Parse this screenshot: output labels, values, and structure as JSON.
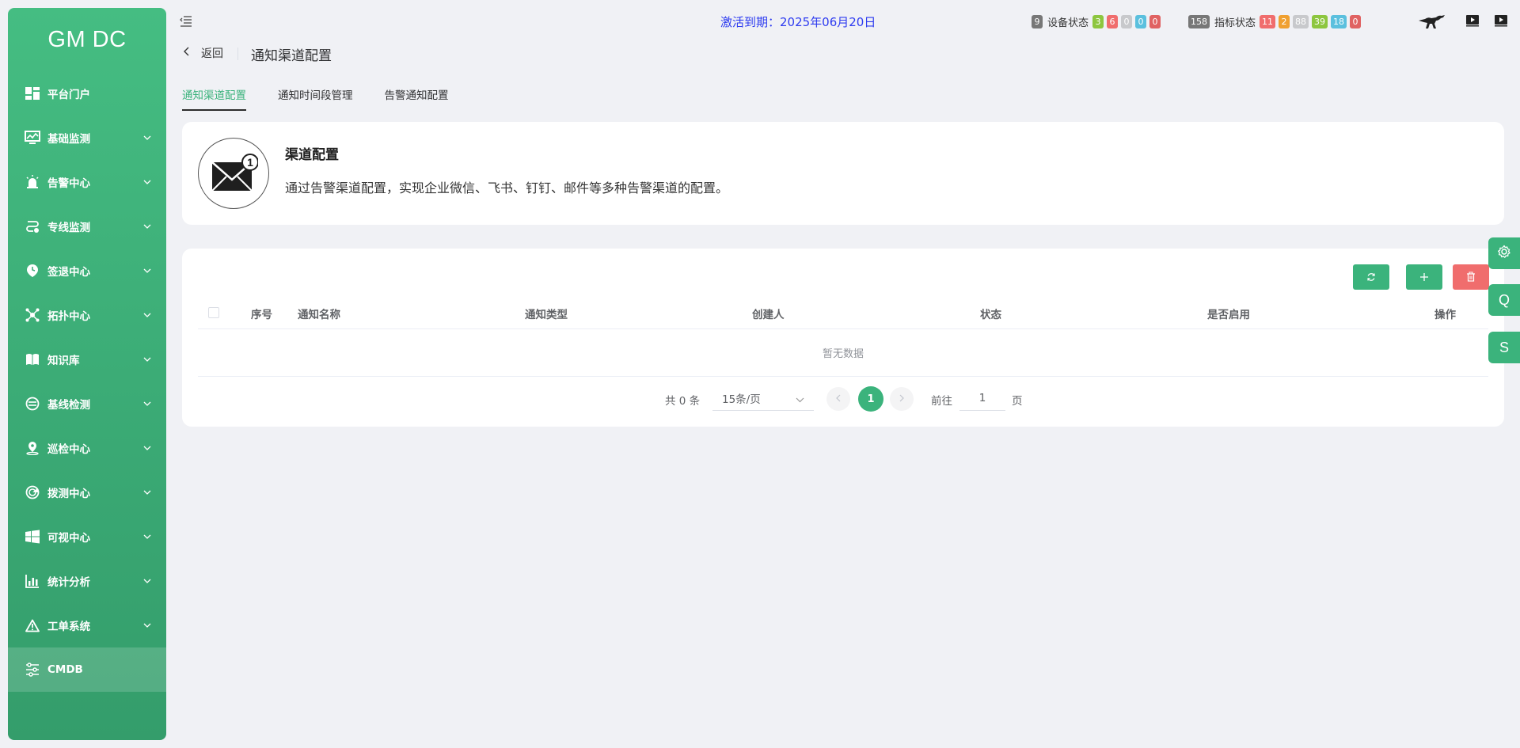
{
  "app": {
    "logo": "GM DC"
  },
  "sidebar": {
    "items": [
      {
        "label": "平台门户",
        "icon": "dashboard-icon",
        "has_children": false
      },
      {
        "label": "基础监测",
        "icon": "monitor-chart-icon",
        "has_children": true
      },
      {
        "label": "告警中心",
        "icon": "alarm-light-icon",
        "has_children": true
      },
      {
        "label": "专线监测",
        "icon": "route-icon",
        "has_children": true
      },
      {
        "label": "签退中心",
        "icon": "clock-pin-icon",
        "has_children": true
      },
      {
        "label": "拓扑中心",
        "icon": "topology-icon",
        "has_children": true
      },
      {
        "label": "知识库",
        "icon": "book-icon",
        "has_children": true
      },
      {
        "label": "基线检测",
        "icon": "baseline-icon",
        "has_children": true
      },
      {
        "label": "巡检中心",
        "icon": "location-pin-icon",
        "has_children": true
      },
      {
        "label": "拨测中心",
        "icon": "radar-icon",
        "has_children": true
      },
      {
        "label": "可视中心",
        "icon": "windows-icon",
        "has_children": true
      },
      {
        "label": "统计分析",
        "icon": "bar-chart-icon",
        "has_children": true
      },
      {
        "label": "工单系统",
        "icon": "warning-triangle-icon",
        "has_children": true
      },
      {
        "label": "CMDB",
        "icon": "sliders-icon",
        "has_children": false,
        "active": true
      }
    ]
  },
  "topbar": {
    "activation_text": "激活到期：2025年06月20日",
    "device_status": {
      "total": "9",
      "label": "设备状态",
      "badges": [
        {
          "value": "3",
          "color": "#8dc63f"
        },
        {
          "value": "6",
          "color": "#f06d6d"
        },
        {
          "value": "0",
          "color": "#c8c9cc"
        },
        {
          "value": "0",
          "color": "#5bc0de"
        },
        {
          "value": "0",
          "color": "#e06262"
        }
      ]
    },
    "metric_status": {
      "total": "158",
      "label": "指标状态",
      "badges": [
        {
          "value": "11",
          "color": "#f06d6d"
        },
        {
          "value": "2",
          "color": "#f0a030"
        },
        {
          "value": "88",
          "color": "#c8c9cc"
        },
        {
          "value": "39",
          "color": "#8dc63f"
        },
        {
          "value": "18",
          "color": "#5bc0de"
        },
        {
          "value": "0",
          "color": "#e06262"
        }
      ]
    }
  },
  "page": {
    "back_label": "返回",
    "title": "通知渠道配置",
    "tabs": [
      {
        "label": "通知渠道配置",
        "active": true
      },
      {
        "label": "通知时间段管理",
        "active": false
      },
      {
        "label": "告警通知配置",
        "active": false
      }
    ]
  },
  "info_card": {
    "title": "渠道配置",
    "description": "通过告警渠道配置，实现企业微信、飞书、钉钉、邮件等多种告警渠道的配置。"
  },
  "table": {
    "columns": [
      "序号",
      "通知名称",
      "通知类型",
      "创建人",
      "状态",
      "是否启用",
      "操作"
    ],
    "rows": [],
    "empty_text": "暂无数据"
  },
  "pagination": {
    "total_text": "共 0 条",
    "page_size": "15条/页",
    "current_page": "1",
    "goto_label": "前往",
    "goto_value": "1",
    "page_unit": "页"
  },
  "floating": {
    "q_label": "Q",
    "s_label": "S"
  },
  "colors": {
    "accent": "#3bb37c",
    "danger": "#f06d6d",
    "link_blue": "#2d3bf0"
  }
}
